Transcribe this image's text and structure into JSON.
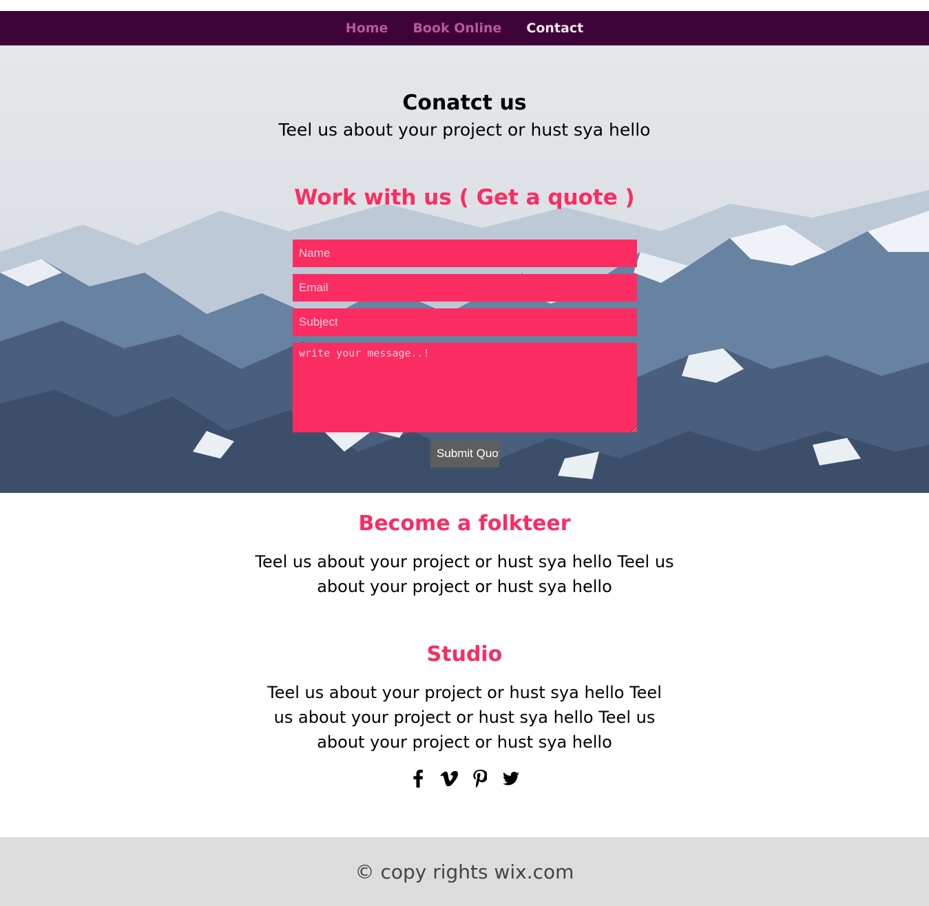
{
  "nav": {
    "items": [
      {
        "label": "Home"
      },
      {
        "label": "Book Online"
      },
      {
        "label": "Contact"
      }
    ]
  },
  "hero": {
    "title": "Conatct us",
    "subtitle": "Teel us about your project or hust sya hello"
  },
  "quote": {
    "title": "Work with us ( Get a quote )",
    "name_placeholder": "Name",
    "email_placeholder": "Email",
    "subject_placeholder": "Subject",
    "message_placeholder": "write your message..!",
    "submit_label": "Submit Quote"
  },
  "folkteer": {
    "title": "Become a folkteer",
    "text_line1": "Teel us about your project or hust sya hello Teel us",
    "text_line2": "about your project or hust sya hello"
  },
  "studio": {
    "title": "Studio",
    "text_line1": "Teel us about your project or hust sya hello Teel",
    "text_line2": "us about your project or hust sya hello Teel us",
    "text_line3": "about your project or hust sya hello"
  },
  "social": {
    "icons": [
      "facebook-icon",
      "vimeo-icon",
      "pinterest-icon",
      "twitter-icon"
    ]
  },
  "footer": {
    "copyright": "© copy rights wix.com"
  },
  "colors": {
    "nav_bg": "#3d0339",
    "nav_link": "#b65b9a",
    "nav_active": "#f3e6f0",
    "accent": "#fb2c62",
    "submit_bg": "#5e5e5e",
    "footer_bg": "#dcdcdc"
  }
}
